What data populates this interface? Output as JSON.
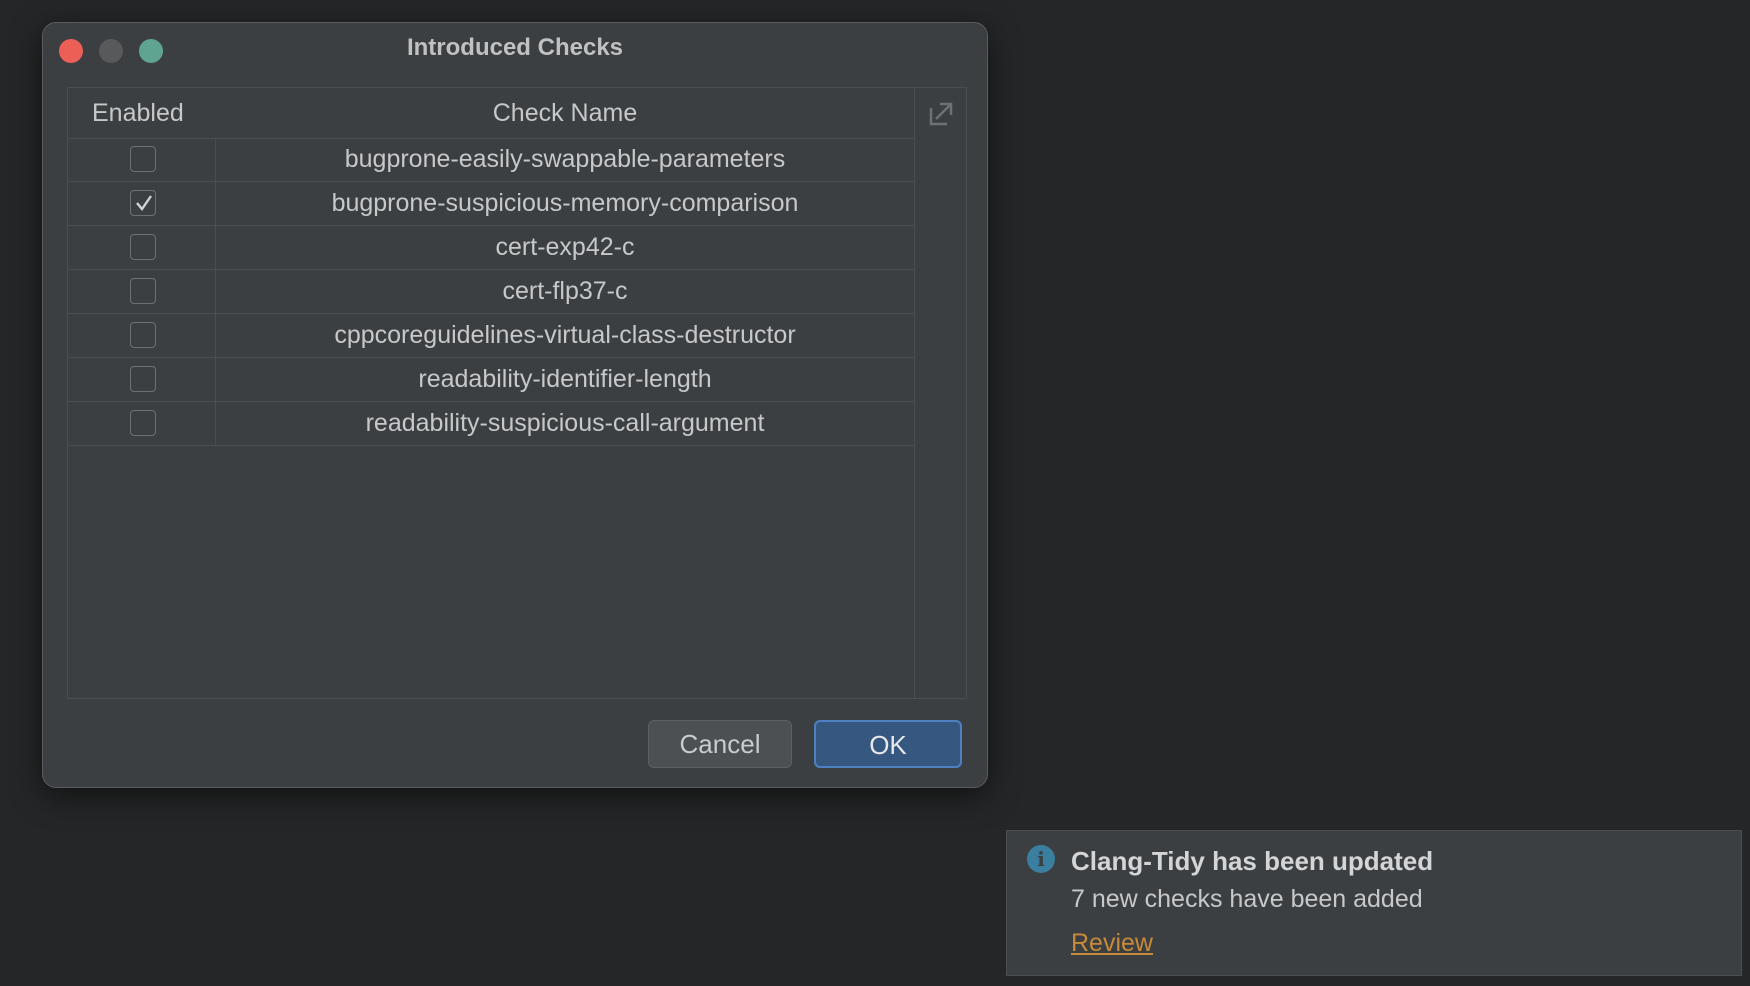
{
  "dialog": {
    "title": "Introduced Checks",
    "columns": {
      "enabled": "Enabled",
      "check_name": "Check Name"
    },
    "rows": [
      {
        "name": "bugprone-easily-swappable-parameters",
        "enabled": false
      },
      {
        "name": "bugprone-suspicious-memory-comparison",
        "enabled": true
      },
      {
        "name": "cert-exp42-c",
        "enabled": false
      },
      {
        "name": "cert-flp37-c",
        "enabled": false
      },
      {
        "name": "cppcoreguidelines-virtual-class-destructor",
        "enabled": false
      },
      {
        "name": "readability-identifier-length",
        "enabled": false
      },
      {
        "name": "readability-suspicious-call-argument",
        "enabled": false
      }
    ],
    "buttons": {
      "cancel": "Cancel",
      "ok": "OK"
    },
    "icons": {
      "export": "export-icon"
    }
  },
  "notification": {
    "icon": "info-icon",
    "title": "Clang-Tidy has been updated",
    "body": "7 new checks have been added",
    "link": "Review"
  },
  "colors": {
    "accent": "#365880",
    "link": "#c58a3a",
    "close": "#ec5f57",
    "zoom": "#5fa491"
  }
}
